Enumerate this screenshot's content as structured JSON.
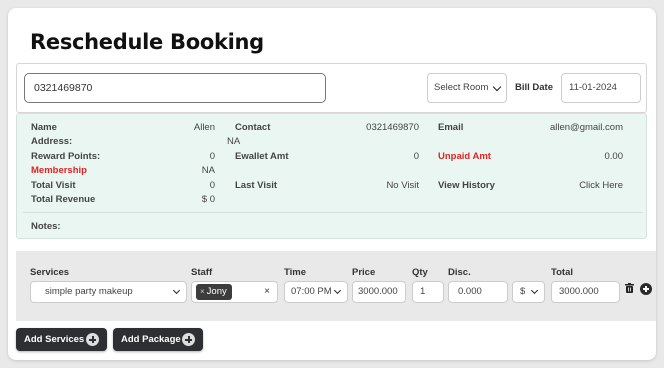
{
  "header": {
    "title": "Reschedule Booking"
  },
  "top": {
    "phone": "0321469870",
    "room_select": "Select Room",
    "bill_date_label": "Bill Date",
    "bill_date": "11-01-2024"
  },
  "info": {
    "name_label": "Name",
    "name": "Allen",
    "contact_label": "Contact",
    "contact": "0321469870",
    "email_label": "Email",
    "email": "allen@gmail.com",
    "address_label": "Address:",
    "address": "NA",
    "reward_label": "Reward Points:",
    "reward": "0",
    "ewallet_label": "Ewallet Amt",
    "ewallet": "0",
    "unpaid_label": "Unpaid Amt",
    "unpaid": "0.00",
    "membership_label": "Membership",
    "membership": "NA",
    "total_visit_label": "Total Visit",
    "total_visit": "0",
    "last_visit_label": "Last Visit",
    "last_visit": "No Visit",
    "history_label": "View History",
    "history_link": "Click Here",
    "revenue_label": "Total Revenue",
    "revenue": "$ 0",
    "notes_label": "Notes:",
    "alert_color": "#e02424"
  },
  "services": {
    "headers": {
      "services": "Services",
      "staff": "Staff",
      "time": "Time",
      "price": "Price",
      "qty": "Qty",
      "disc": "Disc.",
      "total": "Total"
    },
    "service": "simple party makeup",
    "staff_tag": "Jony",
    "staff_tag_remove": "×",
    "staff_clear": "×",
    "time": "07:00 PM",
    "price": "3000.000",
    "qty": "1",
    "disc": "0.000",
    "disc_type": "$",
    "total": "3000.000"
  },
  "buttons": {
    "add_services": "Add Services",
    "add_package": "Add Package"
  }
}
